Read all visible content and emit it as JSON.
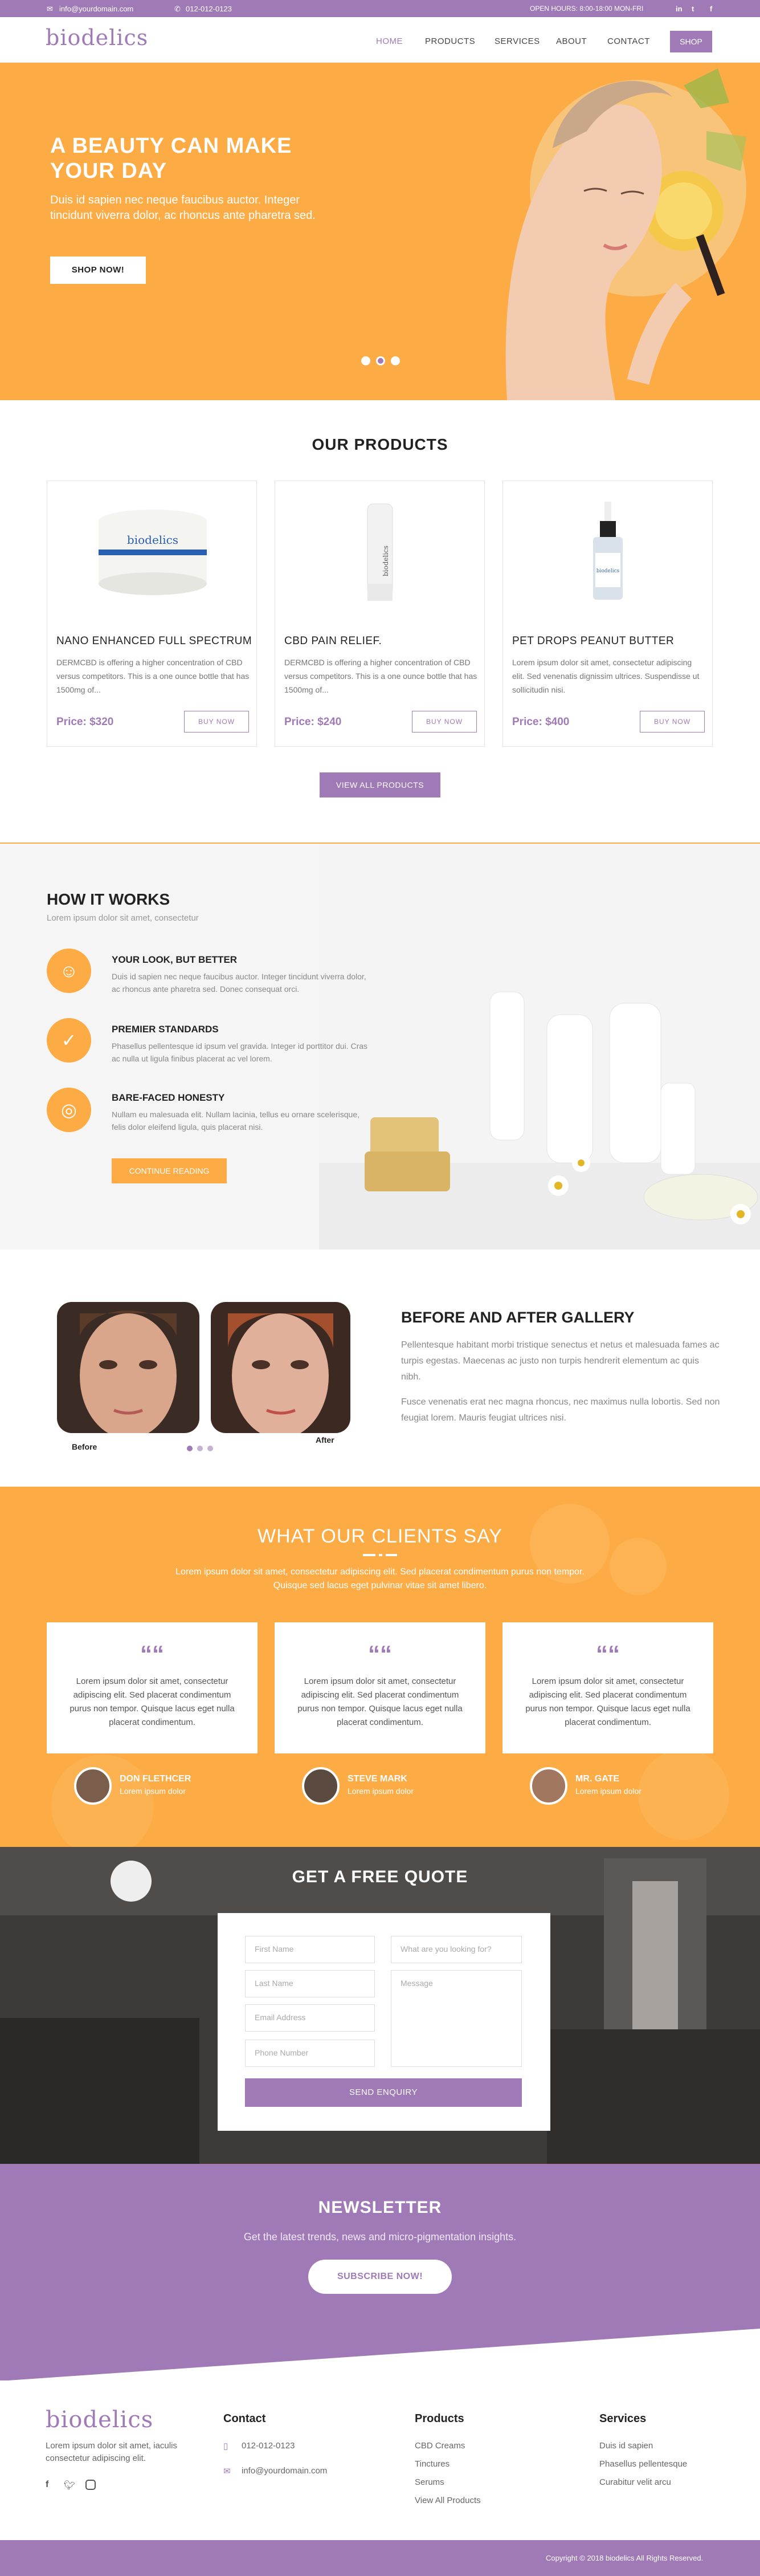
{
  "topbar": {
    "email": "info@yourdomain.com",
    "phone": "012-012-0123",
    "hours": "OPEN HOURS: 8:00-18:00 MON-FRI",
    "social": [
      "in",
      "t",
      "f"
    ]
  },
  "header": {
    "logo": "biodelics",
    "nav": [
      "HOME",
      "PRODUCTS",
      "SERVICES",
      "ABOUT",
      "CONTACT"
    ],
    "shop": "SHOP"
  },
  "hero": {
    "title_line1": "A BEAUTY CAN MAKE",
    "title_line2": "YOUR DAY",
    "text": "Duis id sapien nec neque faucibus auctor. Integer tincidunt viverra dolor, ac rhoncus ante pharetra sed.",
    "cta": "SHOP NOW!",
    "slides_total": 3,
    "slide_active": 2
  },
  "products": {
    "title": "OUR PRODUCTS",
    "items": [
      {
        "name": "NANO ENHANCED FULL SPECTRUM",
        "desc": "DERMCBD is offering a higher concentration of CBD versus competitors. This is a one ounce bottle that has 1500mg of...",
        "price": "Price: $320",
        "buy": "BUY NOW",
        "label": "biodelics"
      },
      {
        "name": "CBD PAIN RELIEF.",
        "desc": "DERMCBD is offering a higher concentration of CBD versus competitors. This is a one ounce bottle that has 1500mg of...",
        "price": "Price: $240",
        "buy": "BUY NOW",
        "label": "biodelics"
      },
      {
        "name": "PET DROPS PEANUT BUTTER",
        "desc": "Lorem ipsum dolor sit amet, consectetur adipiscing elit. Sed venenatis dignissim ultrices. Suspendisse ut sollicitudin nisi.",
        "price": "Price: $400",
        "buy": "BUY NOW",
        "label": "biodelics"
      }
    ],
    "view_all": "VIEW ALL PRODUCTS"
  },
  "how": {
    "title": "HOW IT WORKS",
    "subtitle": "Lorem ipsum dolor sit amet, consectetur",
    "features": [
      {
        "title": "YOUR LOOK, BUT BETTER",
        "text": "Duis id sapien nec neque faucibus auctor. Integer tincidunt viverra dolor, ac rhoncus ante pharetra sed. Donec consequat orci."
      },
      {
        "title": "PREMIER STANDARDS",
        "text": "Phasellus pellentesque id ipsum vel gravida. Integer id porttitor dui. Cras ac nulla ut ligula finibus placerat ac vel lorem."
      },
      {
        "title": "BARE-FACED HONESTY",
        "text": "Nullam eu malesuada elit. Nullam lacinia, tellus eu ornare scelerisque, felis dolor eleifend ligula, quis placerat nisi."
      }
    ],
    "cta": "CONTINUE READING"
  },
  "gallery": {
    "title": "BEFORE AND AFTER GALLERY",
    "p1": "Pellentesque habitant morbi tristique senectus et netus et malesuada fames ac turpis egestas. Maecenas ac justo non turpis hendrerit elementum ac quis nibh.",
    "p2": "Fusce venenatis erat nec magna rhoncus, nec maximus nulla lobortis. Sed non feugiat lorem. Mauris feugiat ultrices nisi.",
    "before": "Before",
    "after": "After",
    "dots_total": 3
  },
  "testimonials": {
    "title": "WHAT OUR CLIENTS SAY",
    "subtitle_l1": "Lorem ipsum dolor sit amet, consectetur adipiscing elit. Sed placerat condimentum purus non tempor.",
    "subtitle_l2": "Quisque sed lacus eget pulvinar vitae sit amet libero.",
    "quote_mark": "““",
    "items": [
      {
        "text": "Lorem ipsum dolor sit amet, consectetur adipiscing elit. Sed placerat condimentum purus non tempor. Quisque lacus eget nulla placerat condimentum.",
        "name": "DON FLETHCER",
        "role": "Lorem ipsum dolor"
      },
      {
        "text": "Lorem ipsum dolor sit amet, consectetur adipiscing elit. Sed placerat condimentum purus non tempor. Quisque lacus eget nulla placerat condimentum.",
        "name": "STEVE MARK",
        "role": "Lorem ipsum dolor"
      },
      {
        "text": "Lorem ipsum dolor sit amet, consectetur adipiscing elit. Sed placerat condimentum purus non tempor. Quisque lacus eget nulla placerat condimentum.",
        "name": "MR. GATE",
        "role": "Lorem ipsum dolor"
      }
    ]
  },
  "quote": {
    "title": "GET A FREE QUOTE",
    "first_name": "First Name",
    "last_name": "Last Name",
    "email": "Email Address",
    "phone": "Phone Number",
    "looking": "What are you looking for?",
    "message": "Message",
    "submit": "SEND ENQUIRY"
  },
  "newsletter": {
    "title": "NEWSLETTER",
    "text": "Get the latest trends, news and micro-pigmentation insights.",
    "cta": "SUBSCRIBE NOW!"
  },
  "footer": {
    "logo": "biodelics",
    "about": "Lorem ipsum dolor sit amet, iaculis consectetur adipiscing elit.",
    "contact_title": "Contact",
    "phone": "012-012-0123",
    "email": "info@yourdomain.com",
    "products_title": "Products",
    "products": [
      "CBD Creams",
      "Tinctures",
      "Serums",
      "View All Products"
    ],
    "services_title": "Services",
    "services": [
      "Duis id sapien",
      "Phasellus pellentesque",
      "Curabitur velit arcu"
    ],
    "copyright": "Copyright © 2018 biodelics All Rights Reserved."
  },
  "colors": {
    "purple": "#a07ab7",
    "orange": "#fdab44"
  },
  "icons": [
    "mail-icon",
    "phone-icon",
    "linkedin-icon",
    "twitter-icon",
    "facebook-icon",
    "instagram-icon",
    "face-icon",
    "shield-icon",
    "mirror-icon",
    "mobile-icon",
    "envelope-icon"
  ]
}
